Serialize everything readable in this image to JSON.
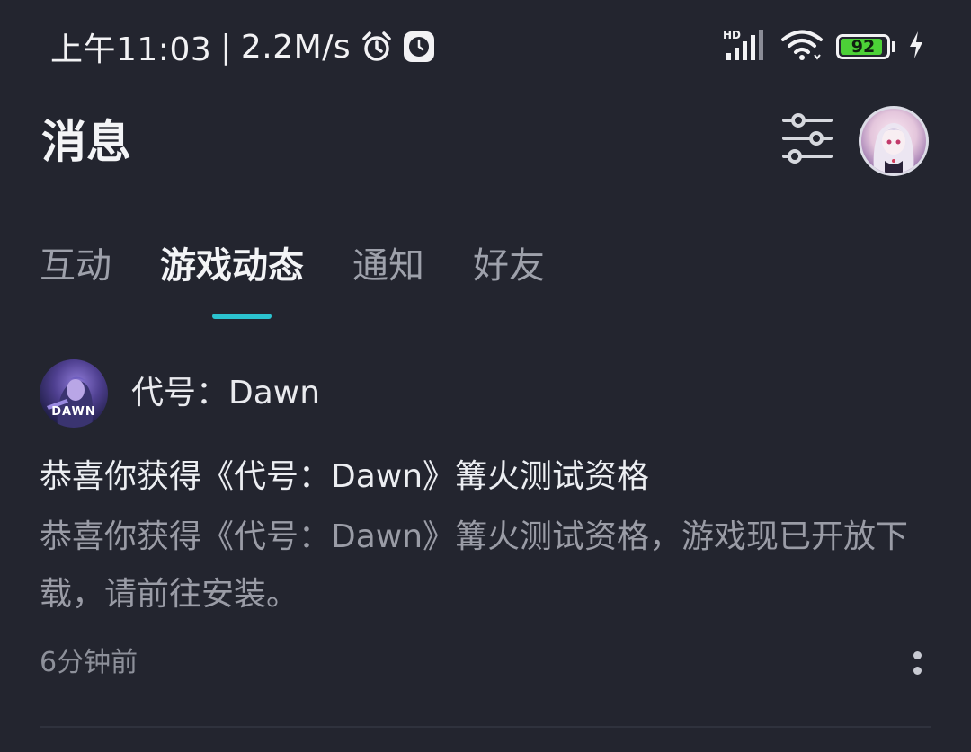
{
  "status_bar": {
    "time": "上午11:03",
    "separator": "|",
    "net_speed": "2.2M/s",
    "alarm_icon": "alarm-clock-icon",
    "app_icon": "clock-app-icon",
    "signal_icon": "hd-signal-icon",
    "signal_label": "HD",
    "wifi_icon": "wifi-icon",
    "battery_level": "92",
    "battery_color": "#4cd137",
    "charging_icon": "lightning-icon"
  },
  "header": {
    "title": "消息",
    "filter_icon": "sliders-icon",
    "avatar_icon": "user-avatar"
  },
  "tabs": [
    {
      "label": "互动",
      "active": false
    },
    {
      "label": "游戏动态",
      "active": true
    },
    {
      "label": "通知",
      "active": false
    },
    {
      "label": "好友",
      "active": false
    }
  ],
  "accent_color": "#2bc3cf",
  "message": {
    "game_name": "代号：Dawn",
    "game_logo_text": "DAWN",
    "title": "恭喜你获得《代号：Dawn》篝火测试资格",
    "body": "恭喜你获得《代号：Dawn》篝火测试资格，游戏现已开放下载，请前往安装。",
    "time": "6分钟前",
    "more_icon": "more-vertical-icon"
  }
}
